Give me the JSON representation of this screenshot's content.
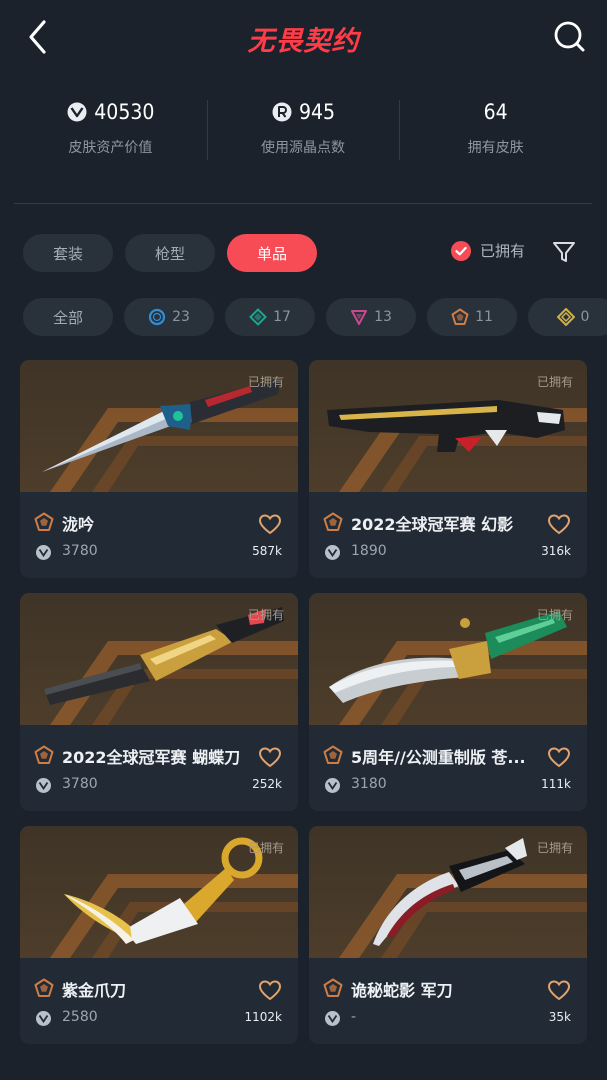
{
  "header": {
    "title": "无畏契约",
    "back_icon": "chevron-left-icon",
    "search_icon": "search-icon"
  },
  "stats": [
    {
      "icon": "vp-coin-icon",
      "value": "40530",
      "label": "皮肤资产价值"
    },
    {
      "icon": "radianite-icon",
      "value": "945",
      "label": "使用源晶点数"
    },
    {
      "icon": "",
      "value": "64",
      "label": "拥有皮肤"
    }
  ],
  "tabs": [
    {
      "label": "套装",
      "active": false
    },
    {
      "label": "枪型",
      "active": false
    },
    {
      "label": "单品",
      "active": true
    }
  ],
  "owned_filter": {
    "label": "已拥有",
    "checked": true,
    "accent": "#f74c56"
  },
  "tiers": [
    {
      "label": "全部",
      "count": ""
    },
    {
      "tier": "select",
      "count": "23",
      "color": "#2f8fd6"
    },
    {
      "tier": "deluxe",
      "count": "17",
      "color": "#1fa58f"
    },
    {
      "tier": "premium",
      "count": "13",
      "color": "#c84a8e"
    },
    {
      "tier": "exclusive",
      "count": "11",
      "color": "#d07d45"
    },
    {
      "tier": "ultra",
      "count": "0",
      "color": "#d0b049"
    }
  ],
  "skins": [
    {
      "name": "泷吟",
      "price": "3780",
      "likes": "587k",
      "owned": "已拥有",
      "weapon": "kunai"
    },
    {
      "name": "2022全球冠军赛 幻影",
      "price": "1890",
      "likes": "316k",
      "owned": "已拥有",
      "weapon": "rifle"
    },
    {
      "name": "2022全球冠军赛 蝴蝶刀",
      "price": "3780",
      "likes": "252k",
      "owned": "已拥有",
      "weapon": "butterfly"
    },
    {
      "name": "5周年//公测重制版 苍...",
      "price": "3180",
      "likes": "111k",
      "owned": "已拥有",
      "weapon": "dagger"
    },
    {
      "name": "紫金爪刀",
      "price": "2580",
      "likes": "1102k",
      "owned": "已拥有",
      "weapon": "karambit"
    },
    {
      "name": "诡秘蛇影 军刀",
      "price": "-",
      "likes": "35k",
      "owned": "已拥有",
      "weapon": "claw"
    }
  ],
  "colors": {
    "background": "#1b222b",
    "accent": "#f74c56",
    "card": "#222b35",
    "rarity": "#d07d45"
  }
}
